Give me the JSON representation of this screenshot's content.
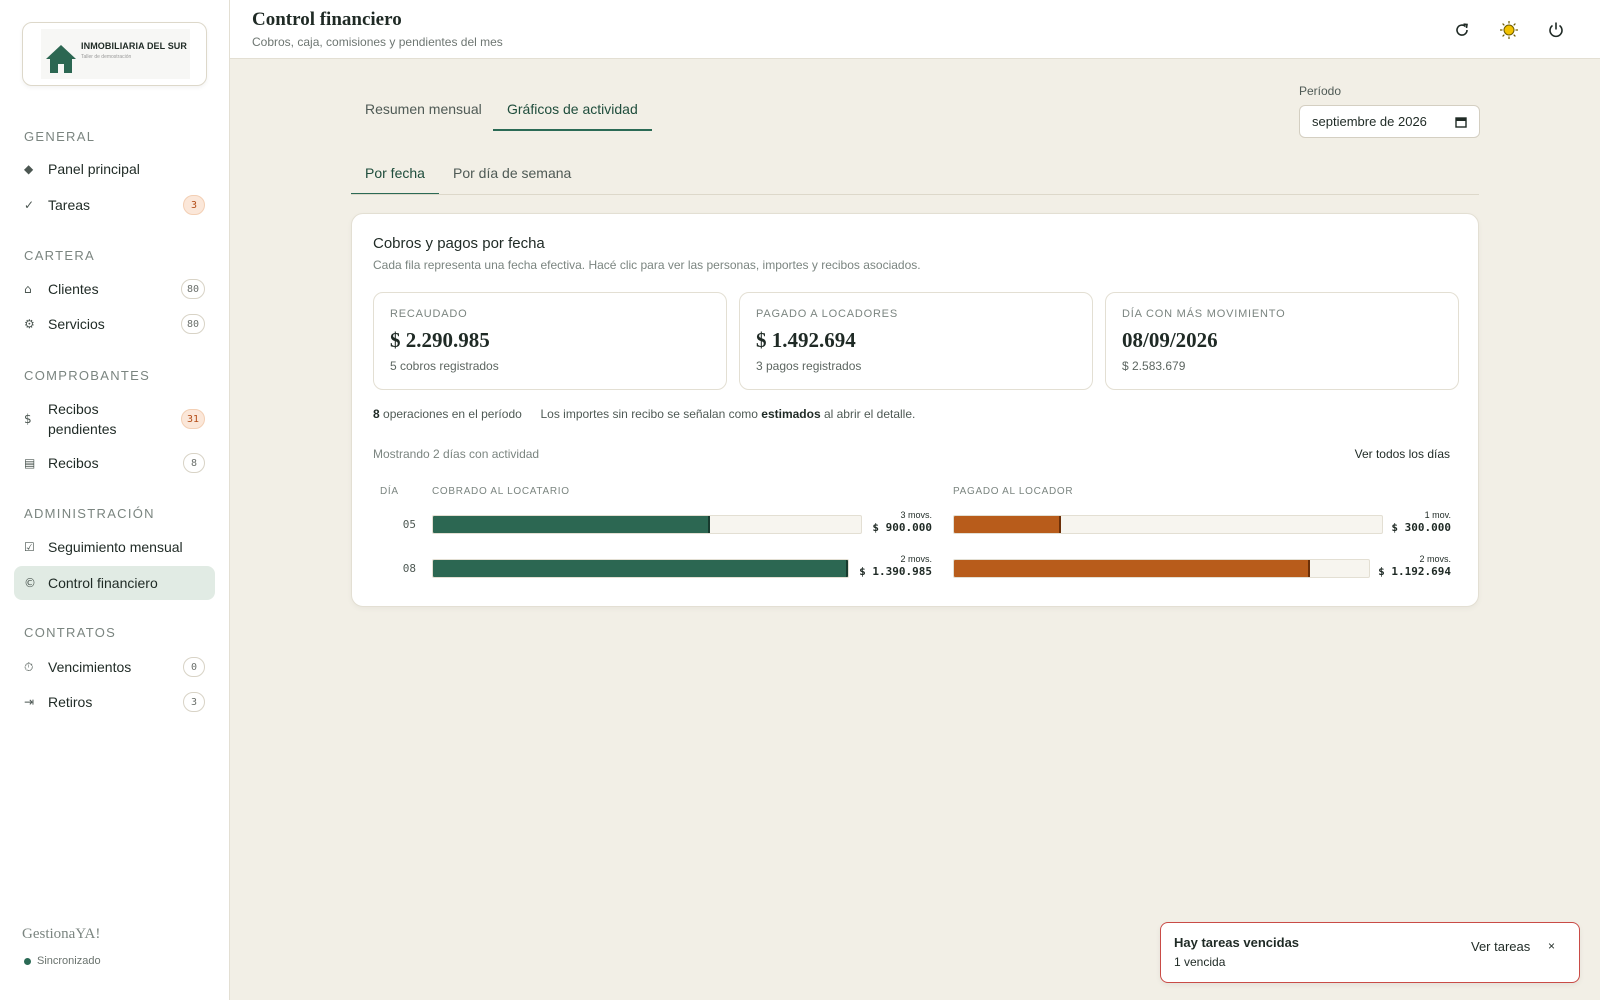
{
  "sidebar": {
    "logo": {
      "name": "INMOBILIARIA DEL SUR",
      "tagline": "Taller de demostración"
    },
    "sections": {
      "general": "GENERAL",
      "cartera": "CARTERA",
      "comprobantes": "COMPROBANTES",
      "administracion": "ADMINISTRACIÓN",
      "contratos": "CONTRATOS"
    },
    "items": {
      "panel": {
        "label": "Panel principal",
        "icon": "diamond-icon"
      },
      "tareas": {
        "label": "Tareas",
        "badge": "3",
        "icon": "check-icon"
      },
      "clientes": {
        "label": "Clientes",
        "badge": "80",
        "icon": "home-icon"
      },
      "servicios": {
        "label": "Servicios",
        "badge": "80",
        "icon": "gear-icon"
      },
      "recibos_pendientes": {
        "label1": "Recibos",
        "label2": "pendientes",
        "badge": "31",
        "icon": "dollar-icon"
      },
      "recibos": {
        "label": "Recibos",
        "badge": "8",
        "icon": "list-icon"
      },
      "seguimiento": {
        "label": "Seguimiento mensual",
        "icon": "checkbox-icon"
      },
      "control": {
        "label": "Control financiero",
        "icon": "copyright-icon"
      },
      "vencimientos": {
        "label": "Vencimientos",
        "badge": "0",
        "icon": "stopwatch-icon"
      },
      "retiros": {
        "label": "Retiros",
        "badge": "3",
        "icon": "arrow-bar-icon"
      }
    },
    "brand": "GestionaYA!",
    "sync_status": "Sincronizado"
  },
  "header": {
    "title": "Control financiero",
    "subtitle": "Cobros, caja, comisiones y pendientes del mes"
  },
  "tabs": {
    "main": [
      "Resumen mensual",
      "Gráficos de actividad"
    ],
    "main_active": "Gráficos de actividad",
    "sub": [
      "Por fecha",
      "Por día de semana"
    ],
    "sub_active": "Por fecha"
  },
  "period": {
    "label": "Período",
    "value": "septiembre de 2026"
  },
  "card": {
    "title": "Cobros y pagos por fecha",
    "subtitle": "Cada fila representa una fecha efectiva. Hacé clic para ver las personas, importes y recibos asociados.",
    "stats": [
      {
        "label": "RECAUDADO",
        "value": "$ 2.290.985",
        "note": "5 cobros registrados"
      },
      {
        "label": "PAGADO A LOCADORES",
        "value": "$ 1.492.694",
        "note": "3 pagos registrados"
      },
      {
        "label": "DÍA CON MÁS MOVIMIENTO",
        "value": "08/09/2026",
        "note": "$ 2.583.679"
      }
    ],
    "ops_count": "8",
    "ops_text": " operaciones en el período",
    "estimate_pre": "Los importes sin recibo se señalan como ",
    "estimate_bold": "estimados",
    "estimate_post": " al abrir el detalle.",
    "showing": "Mostrando 2 días con actividad",
    "see_all": "Ver todos los días",
    "columns": {
      "day": "DÍA",
      "collected": "COBRADO AL LOCATARIO",
      "paid": "PAGADO AL LOCADOR"
    },
    "rows": [
      {
        "day": "05",
        "collected": {
          "movs": "3 movs.",
          "amount": "$ 900.000",
          "fraction": 0.647
        },
        "paid": {
          "movs": "1 mov.",
          "amount": "$ 300.000",
          "fraction": 0.251
        }
      },
      {
        "day": "08",
        "collected": {
          "movs": "2 movs.",
          "amount": "$ 1.390.985",
          "fraction": 1.0
        },
        "paid": {
          "movs": "2 movs.",
          "amount": "$ 1.192.694",
          "fraction": 0.857
        }
      }
    ]
  },
  "toast": {
    "title": "Hay tareas vencidas",
    "subtitle": "1 vencida",
    "action": "Ver tareas",
    "close": "×"
  },
  "colors": {
    "accent": "#2c6752",
    "paid": "#b85c1b",
    "alert": "#c94b46",
    "sun": "#f2c200"
  }
}
